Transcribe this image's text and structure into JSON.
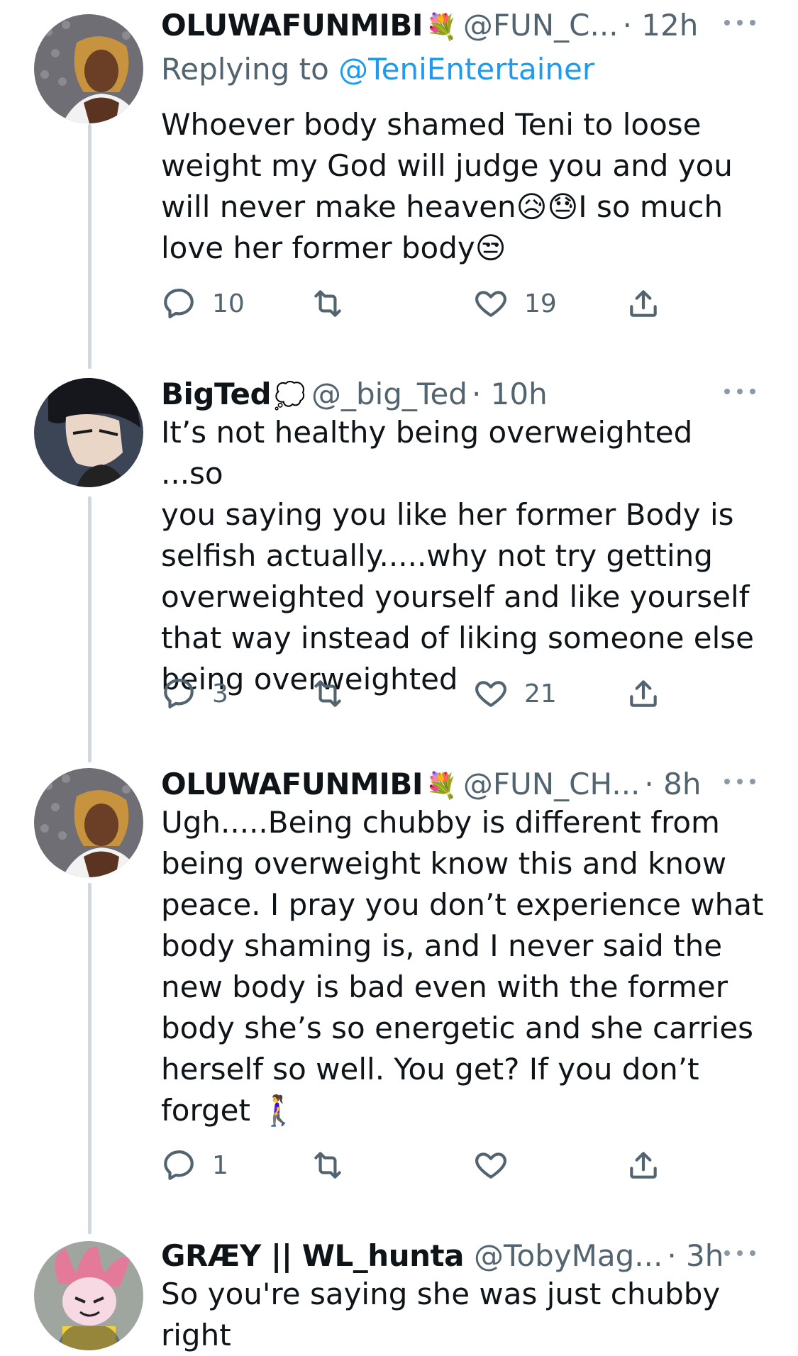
{
  "tweets": [
    {
      "name": "OLUWAFUNMIBI",
      "badge": "💐",
      "handle": "@FUN_C...",
      "time": "· 12h",
      "replying_label": "Replying to ",
      "replying_to": "@TeniEntertainer",
      "text_lines": [
        "Whoever body shamed Teni to loose",
        "weight my God will judge you and you",
        "will never make heaven😥😓I so much",
        "love her former body😒"
      ],
      "replies": "10",
      "retweets": "",
      "likes": "19",
      "avatar_icon": "profile-photo-woman"
    },
    {
      "name": "BigTed",
      "badge": "💭",
      "handle": "@_big_Ted",
      "time": "· 10h",
      "text_lines": [
        "It’s not healthy being overweighted ...so",
        "you saying you like her former Body is",
        "selfish actually.....why not try getting",
        "overweighted yourself and like yourself",
        "that way instead of liking someone else",
        "being overweighted"
      ],
      "replies": "3",
      "retweets": "",
      "likes": "21",
      "avatar_icon": "anime-character-avatar"
    },
    {
      "name": "OLUWAFUNMIBI",
      "badge": "💐",
      "handle": "@FUN_CH...",
      "time": "· 8h",
      "text_lines": [
        "Ugh.....Being chubby is different from",
        "being overweight know this and know",
        "peace. I pray you don’t experience what",
        "body shaming is, and I never said the",
        "new body is bad even with the former",
        "body she’s so energetic and she carries",
        "herself so well. You get? If you don’t",
        "forget 🚶‍♀️"
      ],
      "replies": "1",
      "retweets": "",
      "likes": "",
      "avatar_icon": "profile-photo-woman"
    },
    {
      "name": "GRÆY || WL_hunta",
      "badge": "",
      "handle": "@TobyMag...",
      "time": "· 3h",
      "text_lines": [
        "So you're saying she was just chubby",
        "right"
      ],
      "avatar_icon": "cartoon-character-avatar"
    }
  ],
  "colors": {
    "text": "#0f1419",
    "secondary": "#536471",
    "link": "#1d9bf0",
    "thread_line": "#cfd9de"
  }
}
